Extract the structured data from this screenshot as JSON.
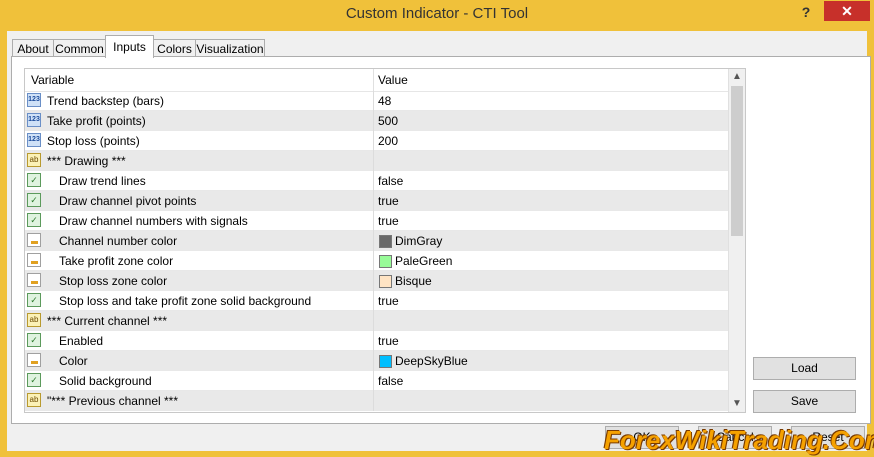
{
  "window": {
    "title": "Custom Indicator - CTI Tool",
    "help_label": "?",
    "close_label": "✕"
  },
  "tabs": [
    {
      "label": "About"
    },
    {
      "label": "Common"
    },
    {
      "label": "Inputs"
    },
    {
      "label": "Colors"
    },
    {
      "label": "Visualization"
    }
  ],
  "active_tab": "Inputs",
  "table": {
    "col_variable": "Variable",
    "col_value": "Value",
    "rows": [
      {
        "icon": "123",
        "type": "number",
        "name": "Trend backstep (bars)",
        "value": "48"
      },
      {
        "icon": "123",
        "type": "number",
        "name": "Take profit (points)",
        "value": "500"
      },
      {
        "icon": "123",
        "type": "number",
        "name": "Stop loss (points)",
        "value": "200"
      },
      {
        "icon": "ab",
        "type": "string",
        "name": "*** Drawing ***",
        "value": ""
      },
      {
        "icon": "bool",
        "type": "bool",
        "name": "Draw trend lines",
        "value": "false"
      },
      {
        "icon": "bool",
        "type": "bool",
        "name": "Draw channel pivot points",
        "value": "true"
      },
      {
        "icon": "bool",
        "type": "bool",
        "name": "Draw channel numbers with signals",
        "value": "true"
      },
      {
        "icon": "color",
        "type": "color",
        "name": "Channel number color",
        "value": "DimGray",
        "swatch": "#696969"
      },
      {
        "icon": "color",
        "type": "color",
        "name": "Take profit zone color",
        "value": "PaleGreen",
        "swatch": "#98fb98"
      },
      {
        "icon": "color",
        "type": "color",
        "name": "Stop loss zone color",
        "value": "Bisque",
        "swatch": "#ffe4c4"
      },
      {
        "icon": "bool",
        "type": "bool",
        "name": "Stop loss and take profit zone solid background",
        "value": "true"
      },
      {
        "icon": "ab",
        "type": "string",
        "name": "*** Current channel ***",
        "value": ""
      },
      {
        "icon": "bool",
        "type": "bool",
        "name": "Enabled",
        "value": "true"
      },
      {
        "icon": "color",
        "type": "color",
        "name": "Color",
        "value": "DeepSkyBlue",
        "swatch": "#00bfff"
      },
      {
        "icon": "bool",
        "type": "bool",
        "name": "Solid background",
        "value": "false"
      },
      {
        "icon": "ab",
        "type": "string",
        "name": "\"*** Previous channel ***",
        "value": ""
      }
    ]
  },
  "buttons": {
    "load": "Load",
    "save": "Save",
    "ok": "OK",
    "cancel": "Cancel",
    "reset": "Reset"
  },
  "watermark": "ForexWikiTrading.Com",
  "colors": {
    "title_bar": "#f0c13a",
    "close_button": "#c7302a",
    "watermark": "#f5a100"
  }
}
